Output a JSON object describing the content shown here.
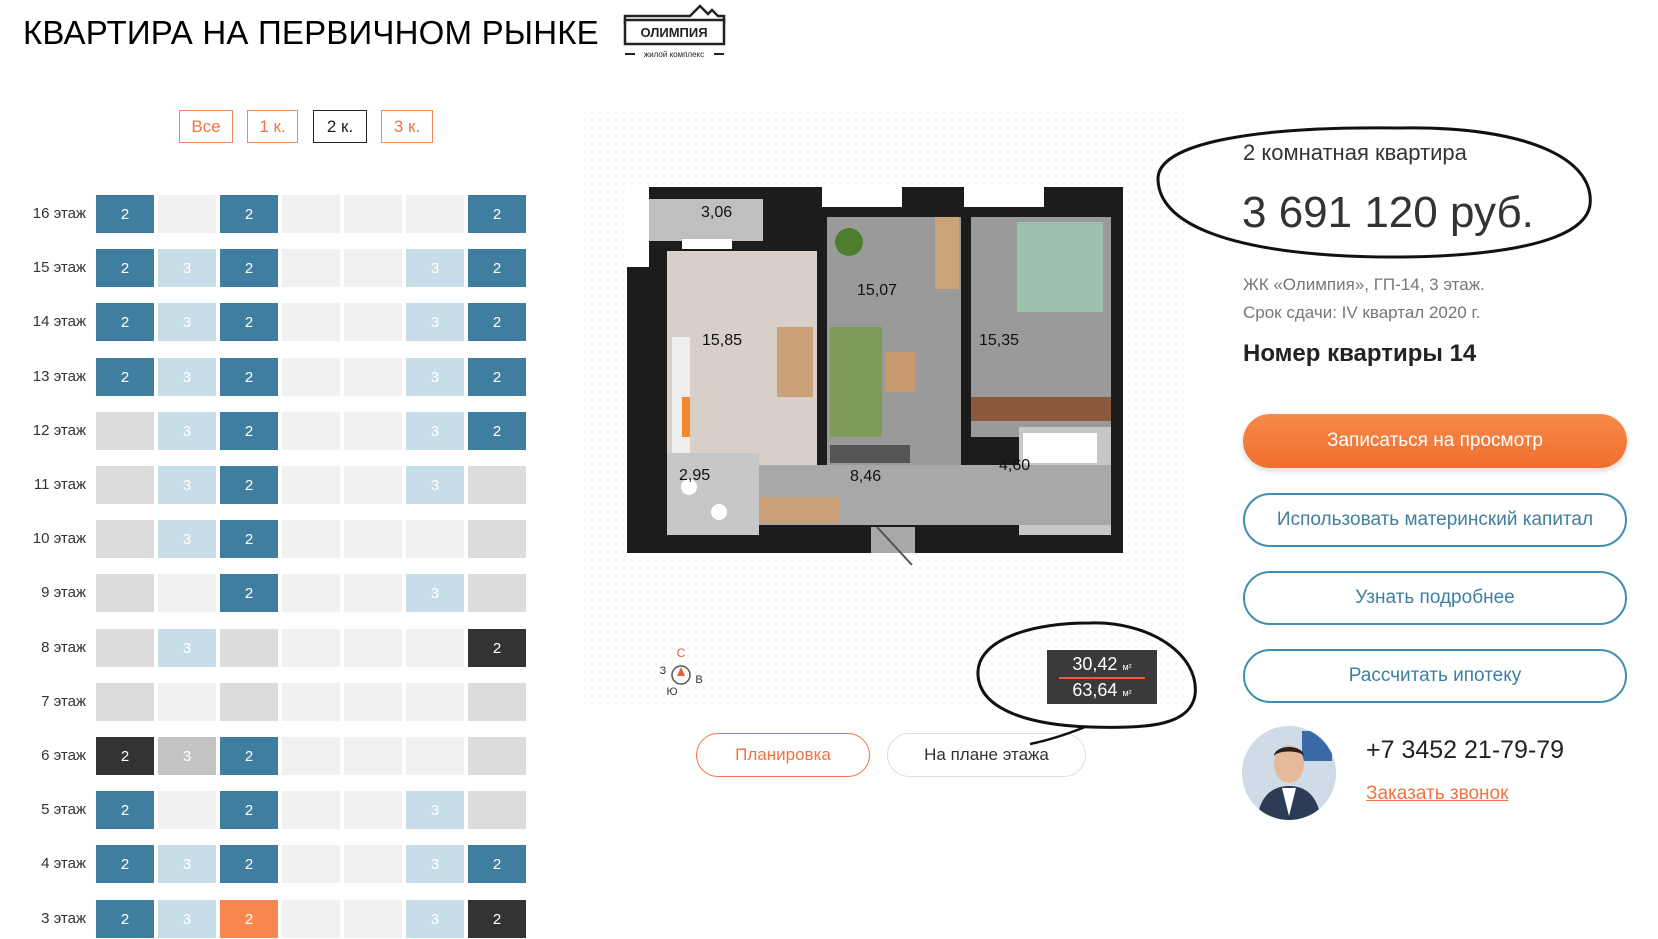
{
  "header": {
    "title": "КВАРТИРА НА ПЕРВИЧНОМ РЫНКЕ",
    "logo_name": "ОЛИМПИЯ",
    "logo_subtitle": "жилой комплекс"
  },
  "filters": [
    {
      "label": "Все",
      "active": false
    },
    {
      "label": "1 к.",
      "active": false
    },
    {
      "label": "2 к.",
      "active": true
    },
    {
      "label": "3 к.",
      "active": false
    }
  ],
  "floors": [
    {
      "label": "16 этаж",
      "cells": [
        [
          "blue",
          "2"
        ],
        [
          "empty",
          ""
        ],
        [
          "blue",
          "2"
        ],
        [
          "empty",
          ""
        ],
        [
          "empty",
          ""
        ],
        [
          "empty",
          ""
        ],
        [
          "blue",
          "2"
        ]
      ]
    },
    {
      "label": "15 этаж",
      "cells": [
        [
          "blue",
          "2"
        ],
        [
          "light",
          "3"
        ],
        [
          "blue",
          "2"
        ],
        [
          "empty",
          ""
        ],
        [
          "empty",
          ""
        ],
        [
          "light",
          "3"
        ],
        [
          "blue",
          "2"
        ]
      ]
    },
    {
      "label": "14 этаж",
      "cells": [
        [
          "blue",
          "2"
        ],
        [
          "light",
          "3"
        ],
        [
          "blue",
          "2"
        ],
        [
          "empty",
          ""
        ],
        [
          "empty",
          ""
        ],
        [
          "light",
          "3"
        ],
        [
          "blue",
          "2"
        ]
      ]
    },
    {
      "label": "13 этаж",
      "cells": [
        [
          "blue",
          "2"
        ],
        [
          "light",
          "3"
        ],
        [
          "blue",
          "2"
        ],
        [
          "empty",
          ""
        ],
        [
          "empty",
          ""
        ],
        [
          "light",
          "3"
        ],
        [
          "blue",
          "2"
        ]
      ]
    },
    {
      "label": "12 этаж",
      "cells": [
        [
          "gray",
          ""
        ],
        [
          "light",
          "3"
        ],
        [
          "blue",
          "2"
        ],
        [
          "empty",
          ""
        ],
        [
          "empty",
          ""
        ],
        [
          "light",
          "3"
        ],
        [
          "blue",
          "2"
        ]
      ]
    },
    {
      "label": "11 этаж",
      "cells": [
        [
          "gray",
          ""
        ],
        [
          "light",
          "3"
        ],
        [
          "blue",
          "2"
        ],
        [
          "empty",
          ""
        ],
        [
          "empty",
          ""
        ],
        [
          "light",
          "3"
        ],
        [
          "gray",
          ""
        ]
      ]
    },
    {
      "label": "10 этаж",
      "cells": [
        [
          "gray",
          ""
        ],
        [
          "light",
          "3"
        ],
        [
          "blue",
          "2"
        ],
        [
          "empty",
          ""
        ],
        [
          "empty",
          ""
        ],
        [
          "empty",
          ""
        ],
        [
          "gray",
          ""
        ]
      ]
    },
    {
      "label": "9 этаж",
      "cells": [
        [
          "gray",
          ""
        ],
        [
          "empty",
          ""
        ],
        [
          "blue",
          "2"
        ],
        [
          "empty",
          ""
        ],
        [
          "empty",
          ""
        ],
        [
          "light",
          "3"
        ],
        [
          "gray",
          ""
        ]
      ]
    },
    {
      "label": "8 этаж",
      "cells": [
        [
          "gray",
          ""
        ],
        [
          "light",
          "3"
        ],
        [
          "gray",
          ""
        ],
        [
          "empty",
          ""
        ],
        [
          "empty",
          ""
        ],
        [
          "empty",
          ""
        ],
        [
          "dark",
          "2"
        ]
      ]
    },
    {
      "label": "7 этаж",
      "cells": [
        [
          "gray",
          ""
        ],
        [
          "empty",
          ""
        ],
        [
          "gray",
          ""
        ],
        [
          "empty",
          ""
        ],
        [
          "empty",
          ""
        ],
        [
          "empty",
          ""
        ],
        [
          "gray",
          ""
        ]
      ]
    },
    {
      "label": "6 этаж",
      "cells": [
        [
          "dark",
          "2"
        ],
        [
          "midgray",
          "3"
        ],
        [
          "blue",
          "2"
        ],
        [
          "empty",
          ""
        ],
        [
          "empty",
          ""
        ],
        [
          "empty",
          ""
        ],
        [
          "gray",
          ""
        ]
      ]
    },
    {
      "label": "5 этаж",
      "cells": [
        [
          "blue",
          "2"
        ],
        [
          "empty",
          ""
        ],
        [
          "blue",
          "2"
        ],
        [
          "empty",
          ""
        ],
        [
          "empty",
          ""
        ],
        [
          "light",
          "3"
        ],
        [
          "gray",
          ""
        ]
      ]
    },
    {
      "label": "4 этаж",
      "cells": [
        [
          "blue",
          "2"
        ],
        [
          "light",
          "3"
        ],
        [
          "blue",
          "2"
        ],
        [
          "empty",
          ""
        ],
        [
          "empty",
          ""
        ],
        [
          "light",
          "3"
        ],
        [
          "blue",
          "2"
        ]
      ]
    },
    {
      "label": "3 этаж",
      "cells": [
        [
          "blue",
          "2"
        ],
        [
          "light",
          "3"
        ],
        [
          "orange",
          "2"
        ],
        [
          "empty",
          ""
        ],
        [
          "empty",
          ""
        ],
        [
          "light",
          "3"
        ],
        [
          "dark",
          "2"
        ]
      ]
    }
  ],
  "plan": {
    "rooms": [
      "3,06",
      "15,85",
      "15,07",
      "15,35",
      "2,95",
      "8,46",
      "4,60"
    ],
    "compass": {
      "n": "С",
      "w": "З",
      "e": "В",
      "s": "Ю"
    },
    "area_living": "30,42",
    "area_total": "63,64",
    "area_unit": "м²"
  },
  "view_buttons": {
    "plan": "Планировка",
    "floor": "На плане этажа"
  },
  "info": {
    "apt_type": "2 комнатная квартира",
    "price": "3 691 120 руб.",
    "complex": "ЖК «Олимпия», ГП-14, 3 этаж.",
    "deadline": "Срок сдачи: IV квартал 2020 г.",
    "apt_number": "Номер квартиры 14"
  },
  "actions": {
    "book_view": "Записаться на просмотр",
    "maternity": "Использовать материнский капитал",
    "more": "Узнать подробнее",
    "mortgage": "Рассчитать ипотеку"
  },
  "contact": {
    "phone": "+7 3452  21-79-79",
    "callback": "Заказать звонок"
  },
  "colors": {
    "blue": "#3f7e9f",
    "light": "#c7dde8",
    "gray": "#dcdcdc",
    "empty": "#f1f1f1",
    "dark": "#333333",
    "midgray": "#c4c4c4",
    "orange": "#f7874f",
    "accent": "#ef7442"
  }
}
